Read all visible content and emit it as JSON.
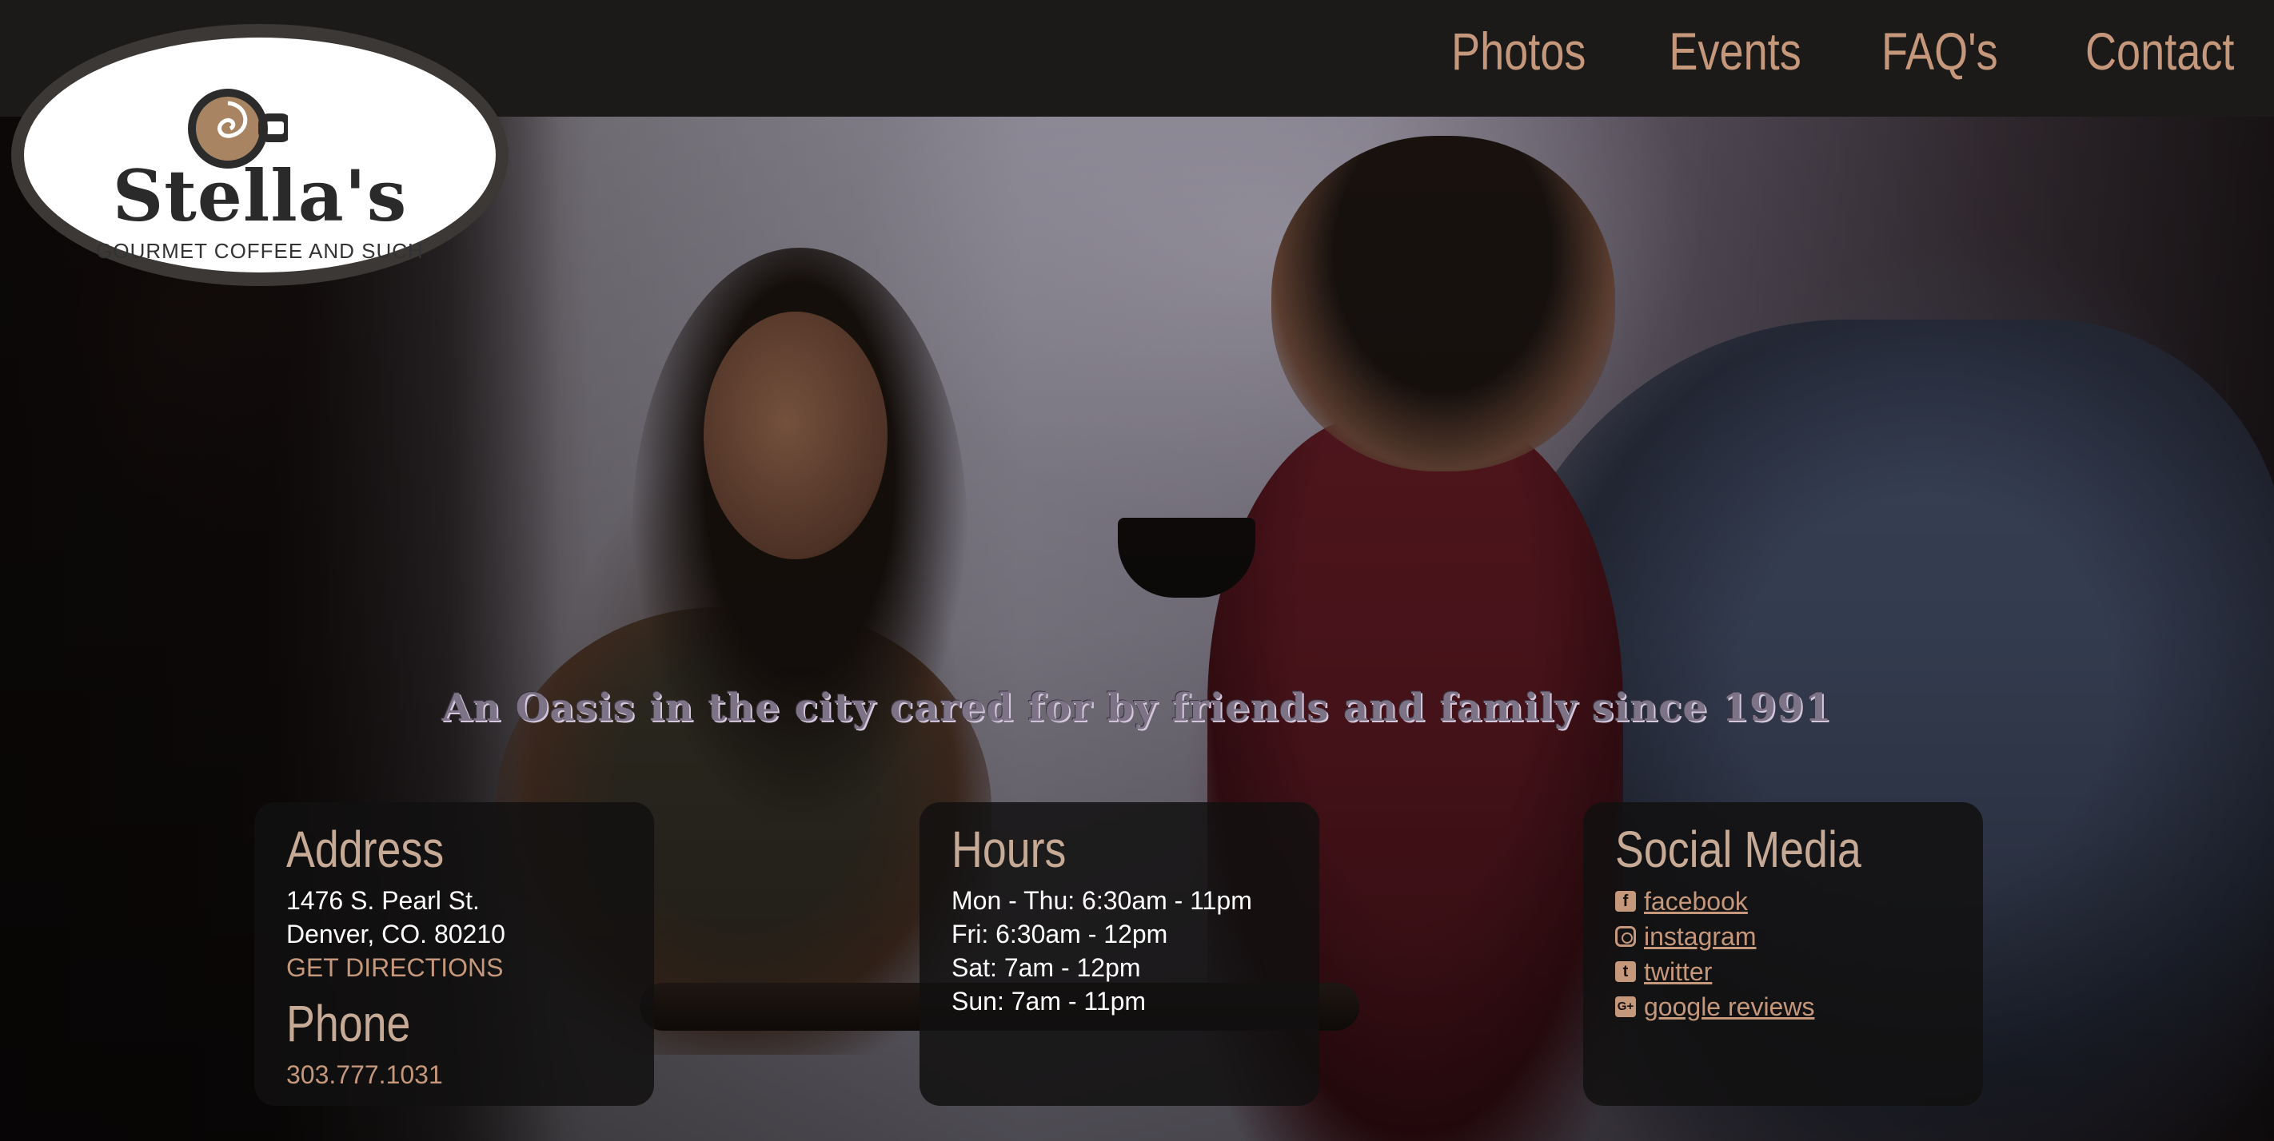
{
  "brand": {
    "name": "Stella's",
    "tagline_small": "GOURMET COFFEE AND SUCH"
  },
  "nav": [
    {
      "label": "Photos"
    },
    {
      "label": "Events"
    },
    {
      "label": "FAQ's"
    },
    {
      "label": "Contact"
    }
  ],
  "hero": {
    "tagline": "An Oasis in the city cared for by friends and family since 1991"
  },
  "address": {
    "heading": "Address",
    "street": "1476 S. Pearl St.",
    "city": "Denver, CO. 80210",
    "directions_link": "GET DIRECTIONS",
    "phone_heading": "Phone",
    "phone": "303.777.1031"
  },
  "hours": {
    "heading": "Hours",
    "lines": [
      "Mon - Thu: 6:30am - 11pm",
      "Fri: 6:30am - 12pm",
      "Sat: 7am - 12pm",
      "Sun: 7am - 11pm"
    ]
  },
  "social": {
    "heading": "Social Media",
    "items": [
      {
        "label": "facebook",
        "icon": "facebook-icon"
      },
      {
        "label": "instagram",
        "icon": "instagram-icon"
      },
      {
        "label": "twitter",
        "icon": "twitter-icon"
      },
      {
        "label": "google reviews",
        "icon": "google-plus-icon"
      }
    ]
  },
  "colors": {
    "header_bg": "#1c1a19",
    "accent": "#c5977b",
    "heading": "#c7aa96",
    "card_bg": "#121010"
  }
}
